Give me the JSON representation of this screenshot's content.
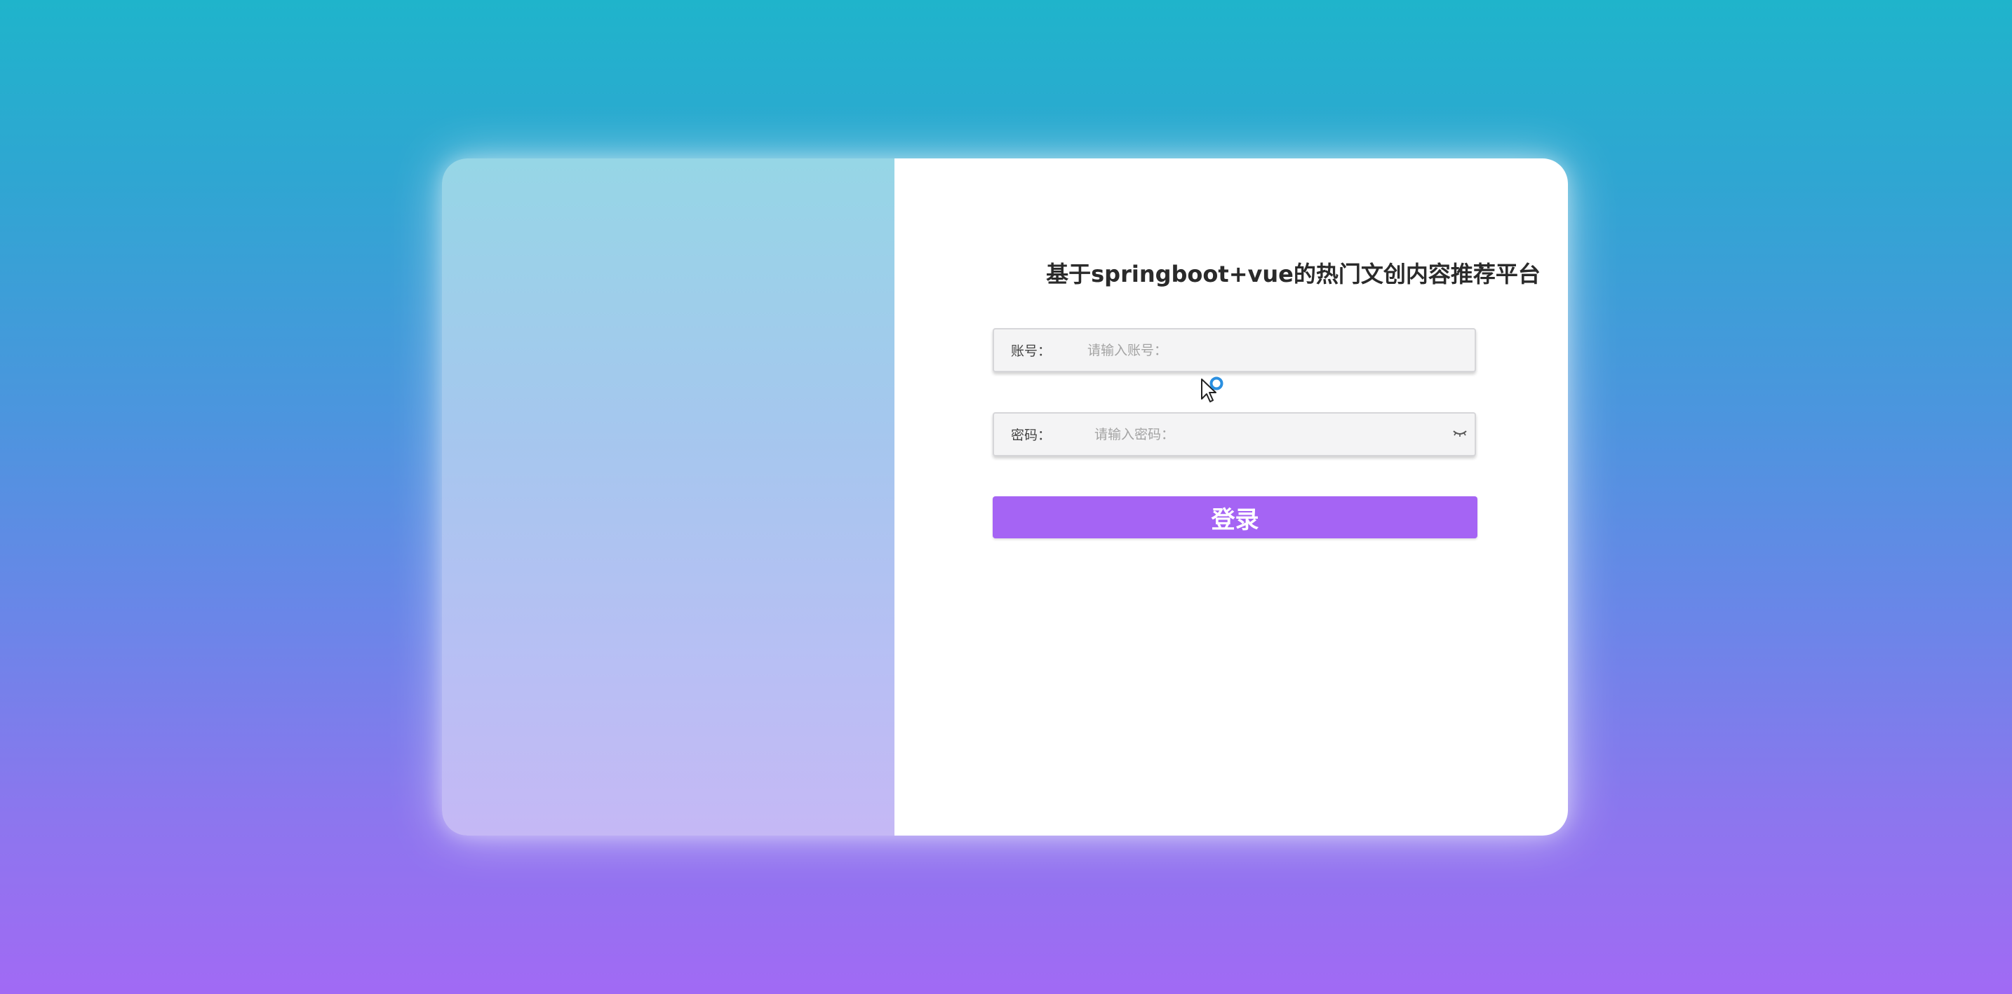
{
  "page": {
    "title": "基于springboot+vue的热门文创内容推荐平台"
  },
  "form": {
    "account": {
      "label": "账号：",
      "placeholder": "请输入账号：",
      "value": ""
    },
    "password": {
      "label": "密码：",
      "placeholder": "请输入密码：",
      "value": "",
      "toggle_icon": "eye-closed-icon"
    },
    "login_label": "登录"
  },
  "colors": {
    "background_top": "#1fb4cb",
    "background_bottom": "#a16af4",
    "left_panel_top": "#96d6e6",
    "left_panel_bottom": "#c5b8f5",
    "button": "#a564f4",
    "title_text": "#2a2a2a"
  },
  "cursor": {
    "icon": "mouse-pointer-busy-icon"
  }
}
